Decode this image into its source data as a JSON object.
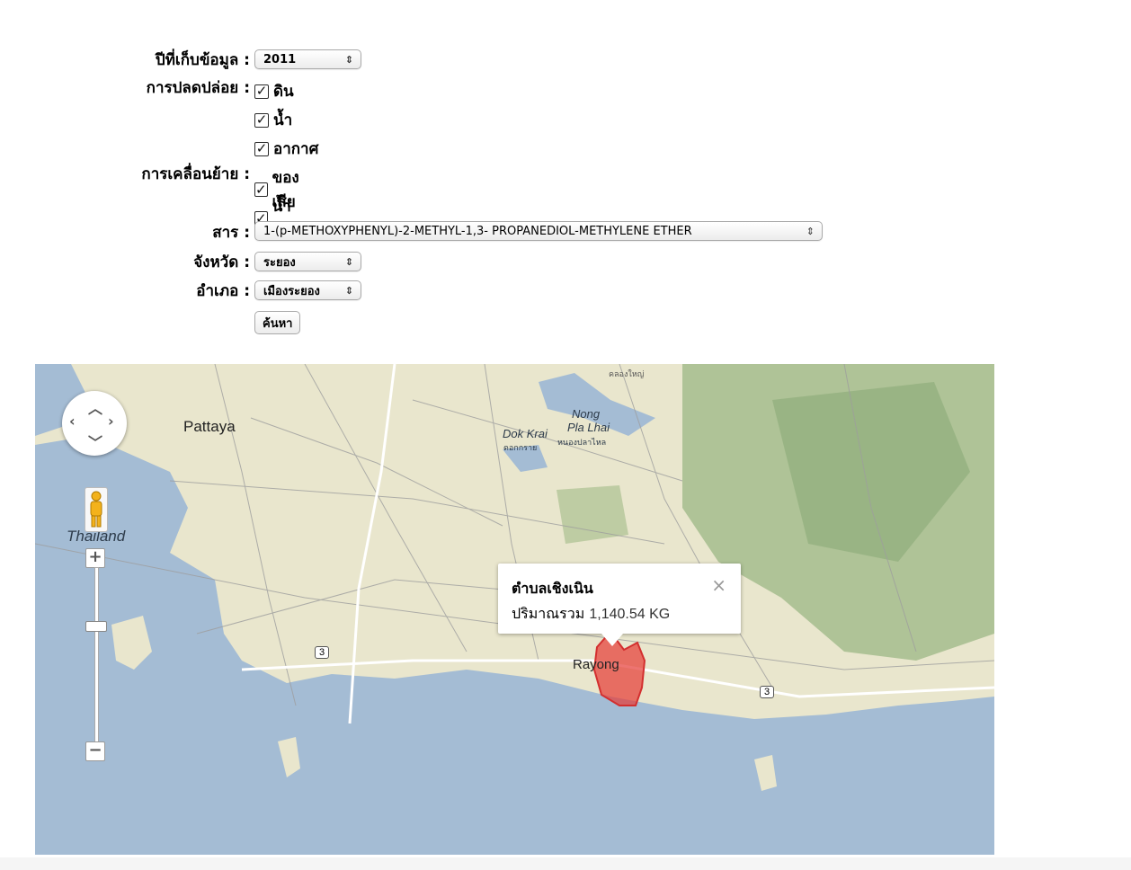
{
  "form": {
    "year": {
      "label": "ปีที่เก็บข้อมูล :",
      "value": "2011"
    },
    "release": {
      "label": "การปลดปล่อย :",
      "options": [
        "ดิน",
        "น้ำ",
        "อากาศ"
      ]
    },
    "transfer": {
      "label": "การเคลื่อนย้าย :",
      "options": [
        "ของเสีย",
        "น้ำเสีย"
      ]
    },
    "substance": {
      "label": "สาร :",
      "value": "1-(p-METHOXYPHENYL)-2-METHYL-1,3- PROPANEDIOL-METHYLENE ETHER"
    },
    "province": {
      "label": "จังหวัด :",
      "value": "ระยอง"
    },
    "district": {
      "label": "อำเภอ :",
      "value": "เมืองระยอง"
    },
    "search_button": "ค้นหา"
  },
  "map": {
    "places": {
      "pattaya": "Pattaya",
      "thailand": "Thailand",
      "nong_pla_lhai_1": "Nong",
      "nong_pla_lhai_2": "Pla Lhai",
      "nong_pla_lhai_th": "หนองปลาไหล",
      "dok_krai": "Dok Krai",
      "dok_krai_th": "ดอกกราย",
      "khlong_yai_th": "คลองใหญ่",
      "rayong": "Rayong",
      "route_3a": "3",
      "route_3b": "3"
    },
    "infowindow": {
      "title": "ตำบลเชิงเนิน",
      "label": "ปริมาณรวม",
      "amount": "1,140.54 KG",
      "close": "×"
    },
    "zoom": {
      "in": "+",
      "out": "−"
    },
    "colors": {
      "water": "#a4bcd4",
      "land": "#e9e6cd",
      "forest": "#9fb88a",
      "highlight": "#e53935"
    }
  }
}
